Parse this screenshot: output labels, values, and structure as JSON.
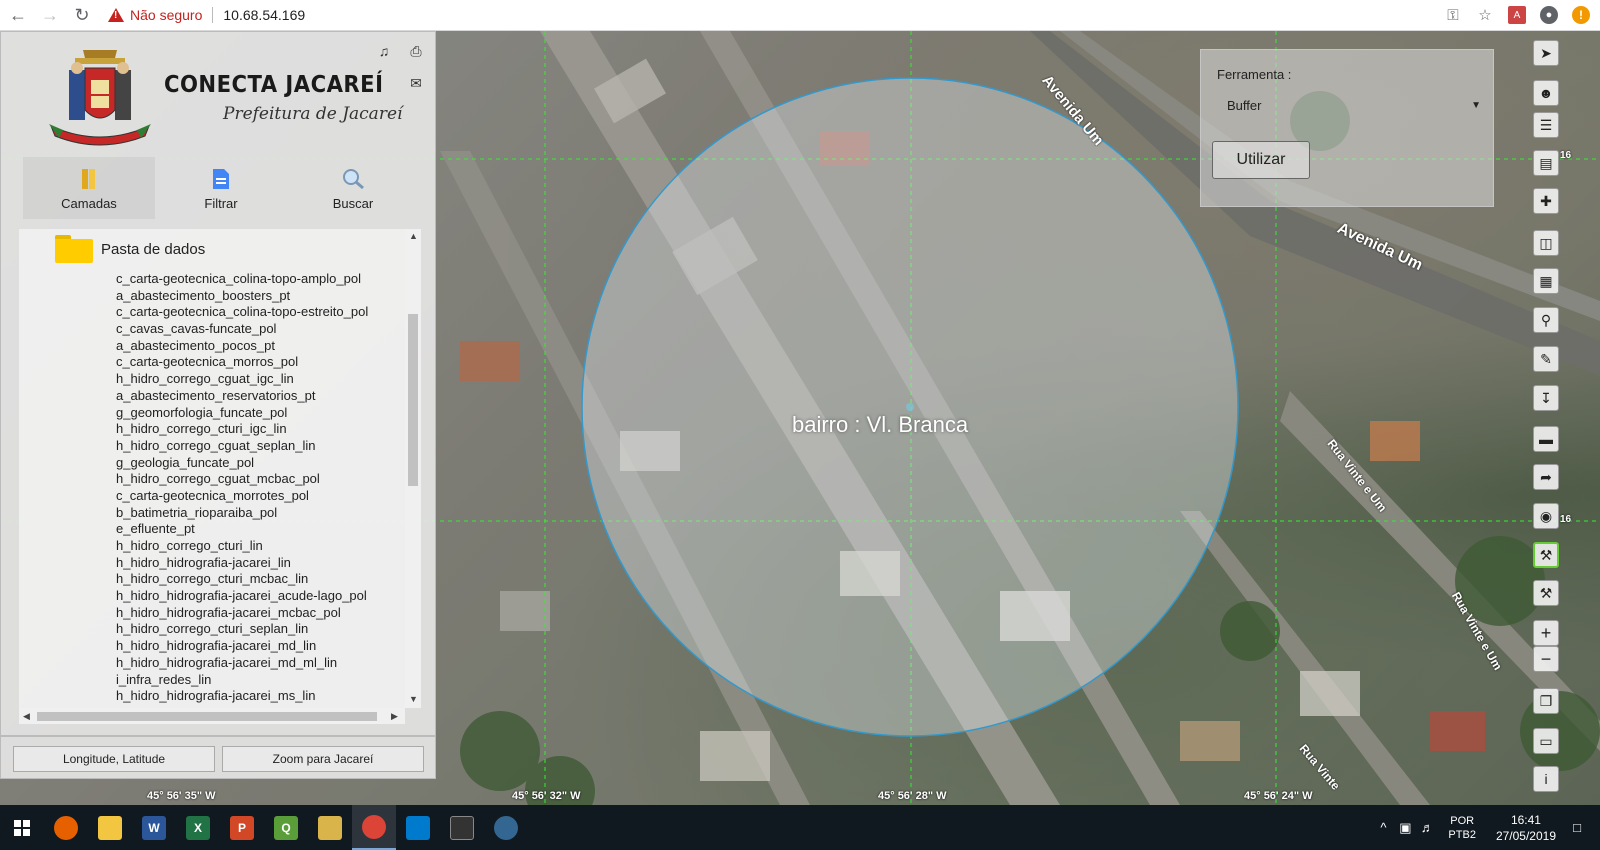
{
  "browser": {
    "security_text": "Não seguro",
    "url": "10.68.54.169"
  },
  "app": {
    "title": "CONECTA JACAREÍ",
    "subtitle": "Prefeitura de Jacareí",
    "tabs": [
      {
        "label": "Camadas",
        "icon": "layers-book-icon"
      },
      {
        "label": "Filtrar",
        "icon": "filter-document-icon"
      },
      {
        "label": "Buscar",
        "icon": "magnifier-icon"
      }
    ],
    "folder_label": "Pasta de dados",
    "layers": [
      "c_carta-geotecnica_colina-topo-amplo_pol",
      "a_abastecimento_boosters_pt",
      "c_carta-geotecnica_colina-topo-estreito_pol",
      "c_cavas_cavas-funcate_pol",
      "a_abastecimento_pocos_pt",
      "c_carta-geotecnica_morros_pol",
      "h_hidro_corrego_cguat_igc_lin",
      "a_abastecimento_reservatorios_pt",
      "g_geomorfologia_funcate_pol",
      "h_hidro_corrego_cturi_igc_lin",
      "h_hidro_corrego_cguat_seplan_lin",
      "g_geologia_funcate_pol",
      "h_hidro_corrego_cguat_mcbac_pol",
      "c_carta-geotecnica_morrotes_pol",
      "b_batimetria_rioparaiba_pol",
      "e_efluente_pt",
      "h_hidro_corrego_cturi_lin",
      "h_hidro_hidrografia-jacarei_lin",
      "h_hidro_corrego_cturi_mcbac_lin",
      "h_hidro_hidrografia-jacarei_acude-lago_pol",
      "h_hidro_hidrografia-jacarei_mcbac_pol",
      "h_hidro_corrego_cturi_seplan_lin",
      "h_hidro_hidrografia-jacarei_md_lin",
      "h_hidro_hidrografia-jacarei_md_ml_lin",
      "i_infra_redes_lin",
      "h_hidro_hidrografia-jacarei_ms_lin"
    ],
    "bottom_buttons": {
      "coords": "Longitude, Latitude",
      "zoom": "Zoom para Jacareí"
    }
  },
  "map": {
    "buffer_label": "bairro : Vl. Branca",
    "street_labels": {
      "avenida_um_top": "Avenida Um",
      "avenida_um_right": "Avenida Um",
      "rua_vinte_e_um_1": "Rua Vinte e Um",
      "rua_vinte_e_um_2": "Rua Vinte e Um",
      "rua_vinte": "Rua Vinte"
    },
    "coordinates": [
      "45° 56' 35\" W",
      "45° 56' 32\" W",
      "45° 56' 28\" W",
      "45° 56' 24\" W"
    ],
    "side_labels": [
      "16",
      "16"
    ]
  },
  "tool_panel": {
    "label": "Ferramenta :",
    "selected": "Buffer",
    "button": "Utilizar"
  },
  "taskbar": {
    "lang_1": "POR",
    "lang_2": "PTB2",
    "time": "16:41",
    "date": "27/05/2019"
  },
  "colors": {
    "buffer_stroke": "#3399cc",
    "grid": "#33ee33",
    "active_tool": "#66cc33"
  }
}
